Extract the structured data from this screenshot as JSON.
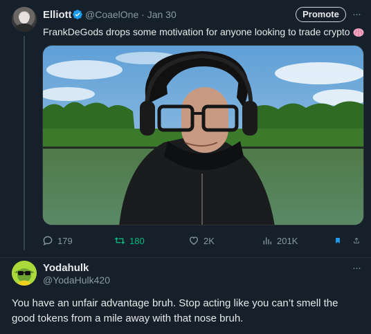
{
  "tweet": {
    "author_name": "Elliott",
    "handle_date": "@CoaelOne · Jan 30",
    "promote_label": "Promote",
    "text": "FrankDeGods drops some motivation for anyone looking to trade crypto",
    "stats": {
      "replies": "179",
      "retweets": "180",
      "likes": "2K",
      "views": "201K"
    }
  },
  "reply": {
    "author_name": "Yodahulk",
    "handle": "@YodaHulk420",
    "text": "You have an unfair advantage bruh. Stop acting like you can’t smell the good tokens from a mile away with that nose bruh."
  },
  "more_label": "···",
  "colors": {
    "background": "#15202b",
    "accent_blue": "#1d9bf0",
    "retweet_green": "#00ba7c",
    "muted_text": "#8b98a5"
  },
  "icons": [
    "verified-badge-icon",
    "brain-icon",
    "reply-icon",
    "retweet-icon",
    "heart-icon",
    "views-icon",
    "bookmark-icon",
    "share-icon",
    "more-icon"
  ]
}
